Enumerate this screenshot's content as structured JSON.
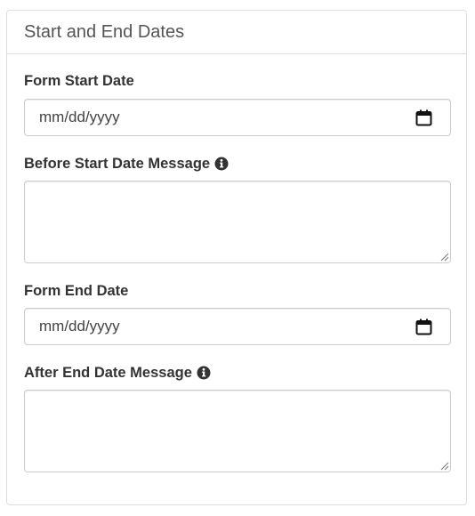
{
  "panel": {
    "title": "Start and End Dates"
  },
  "fields": {
    "form_start_date": {
      "label": "Form Start Date",
      "placeholder": "mm/dd/yyyy"
    },
    "before_start_message": {
      "label": "Before Start Date Message",
      "icon": "info-circle-icon"
    },
    "form_end_date": {
      "label": "Form End Date",
      "placeholder": "mm/dd/yyyy"
    },
    "after_end_message": {
      "label": "After End Date Message",
      "icon": "info-circle-icon"
    }
  },
  "icons": {
    "date_picker": "calendar-icon",
    "resize": "resize-handle-icon"
  },
  "colors": {
    "border": "#dddddd",
    "input_border": "#cccccc",
    "text": "#333333",
    "heading_text": "#555555"
  }
}
